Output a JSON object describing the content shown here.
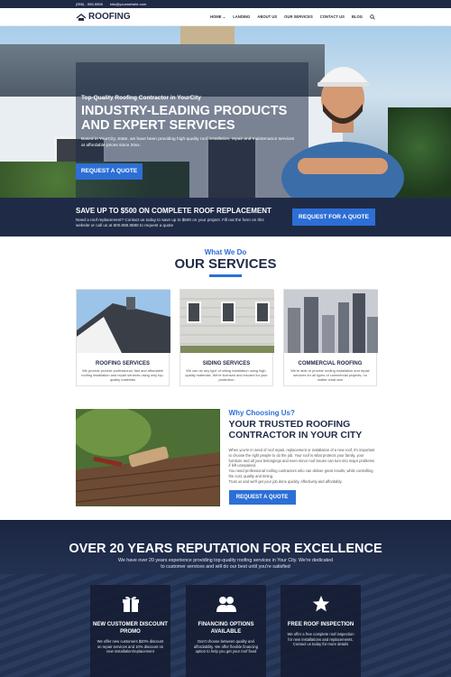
{
  "topbar": {
    "phone": "(555) - 555-5555",
    "email": "info@yourwebsite.com"
  },
  "nav": {
    "logo": "ROOFING",
    "items": [
      "HOME",
      "LANDING",
      "ABOUT US",
      "OUR SERVICES",
      "CONTACT US",
      "BLOG"
    ],
    "home_chevron": "⌄",
    "search_icon": "search-icon"
  },
  "hero": {
    "eyebrow": "Top-Quality Roofing Contractor in YourCity",
    "title": "INDUSTRY-LEADING PRODUCTS AND EXPERT SERVICES",
    "desc": "Based in YourCity, State, we have been providing high-quality roof installation, repair and maintenance services at affordable prices since 20xx.",
    "button": "REQUEST A QUOTE"
  },
  "promo": {
    "title": "SAVE UP TO $500 ON COMPLETE ROOF REPLACEMENT",
    "desc": "Need a roof replacement? Contact us today to save up to $500 on your project. Fill out the form on this website or call us at 800.888.8888 to request a quote",
    "button": "REQUEST FOR A QUOTE"
  },
  "services": {
    "sub": "What We Do",
    "title": "OUR SERVICES",
    "cards": [
      {
        "title": "ROOFING SERVICES",
        "desc": "We provide provide professional, fast and affordable roofing installation and repair services using only top-quality materials"
      },
      {
        "title": "SIDING SERVICES",
        "desc": "We can do any type of siding installation using high-quality materials. We're licensed and insured for your protection"
      },
      {
        "title": "COMMERCIAL ROOFING",
        "desc": "We're able to provide roofing installation and repair services for all types of commercial projects, no matter what size"
      }
    ]
  },
  "why": {
    "sub": "Why Choosing Us?",
    "title": "YOUR TRUSTED ROOFING CONTRACTOR IN YOUR CITY",
    "desc1": "When you're in need of roof repair, replacement or installation of a new roof, it's important to choose the right people to do the job. Your roof is what protects your family, your furniture and all your belongings and even minor roof issues can turn into major problems if left unrepaired.",
    "desc2": "You need professional roofing contractors who can deliver great results, while controlling the cost, quality and timing.",
    "desc3": "Trust us and we'll get your job done quickly, effectively and affordably.",
    "button": "REQUEST A QUOTE"
  },
  "reputation": {
    "title": "OVER 20 YEARS REPUTATION FOR EXCELLENCE",
    "desc": "We have over 20 years experience providing top-quality roofing services in Your City. We're dedicated to customer services and will do our best until you're satisfied",
    "features": [
      {
        "icon": "gift-icon",
        "title": "NEW CUSTOMER DISCOUNT PROMO",
        "desc": "We offer new customers $20% discount on repair services and 10% discount on new installation/replacement"
      },
      {
        "icon": "users-icon",
        "title": "FINANCING OPTIONS AVAILABLE",
        "desc": "Don't choose between quality and affordability. We offer flexible financing option to help you get your roof fixed"
      },
      {
        "icon": "star-icon",
        "title": "FREE ROOF INSPECTION",
        "desc": "We offer a free complete roof inspection for new installations and replacements. Contact us today for more details"
      }
    ]
  },
  "colors": {
    "navy": "#1f2b46",
    "accent_blue": "#2d6fd6",
    "white": "#ffffff"
  }
}
